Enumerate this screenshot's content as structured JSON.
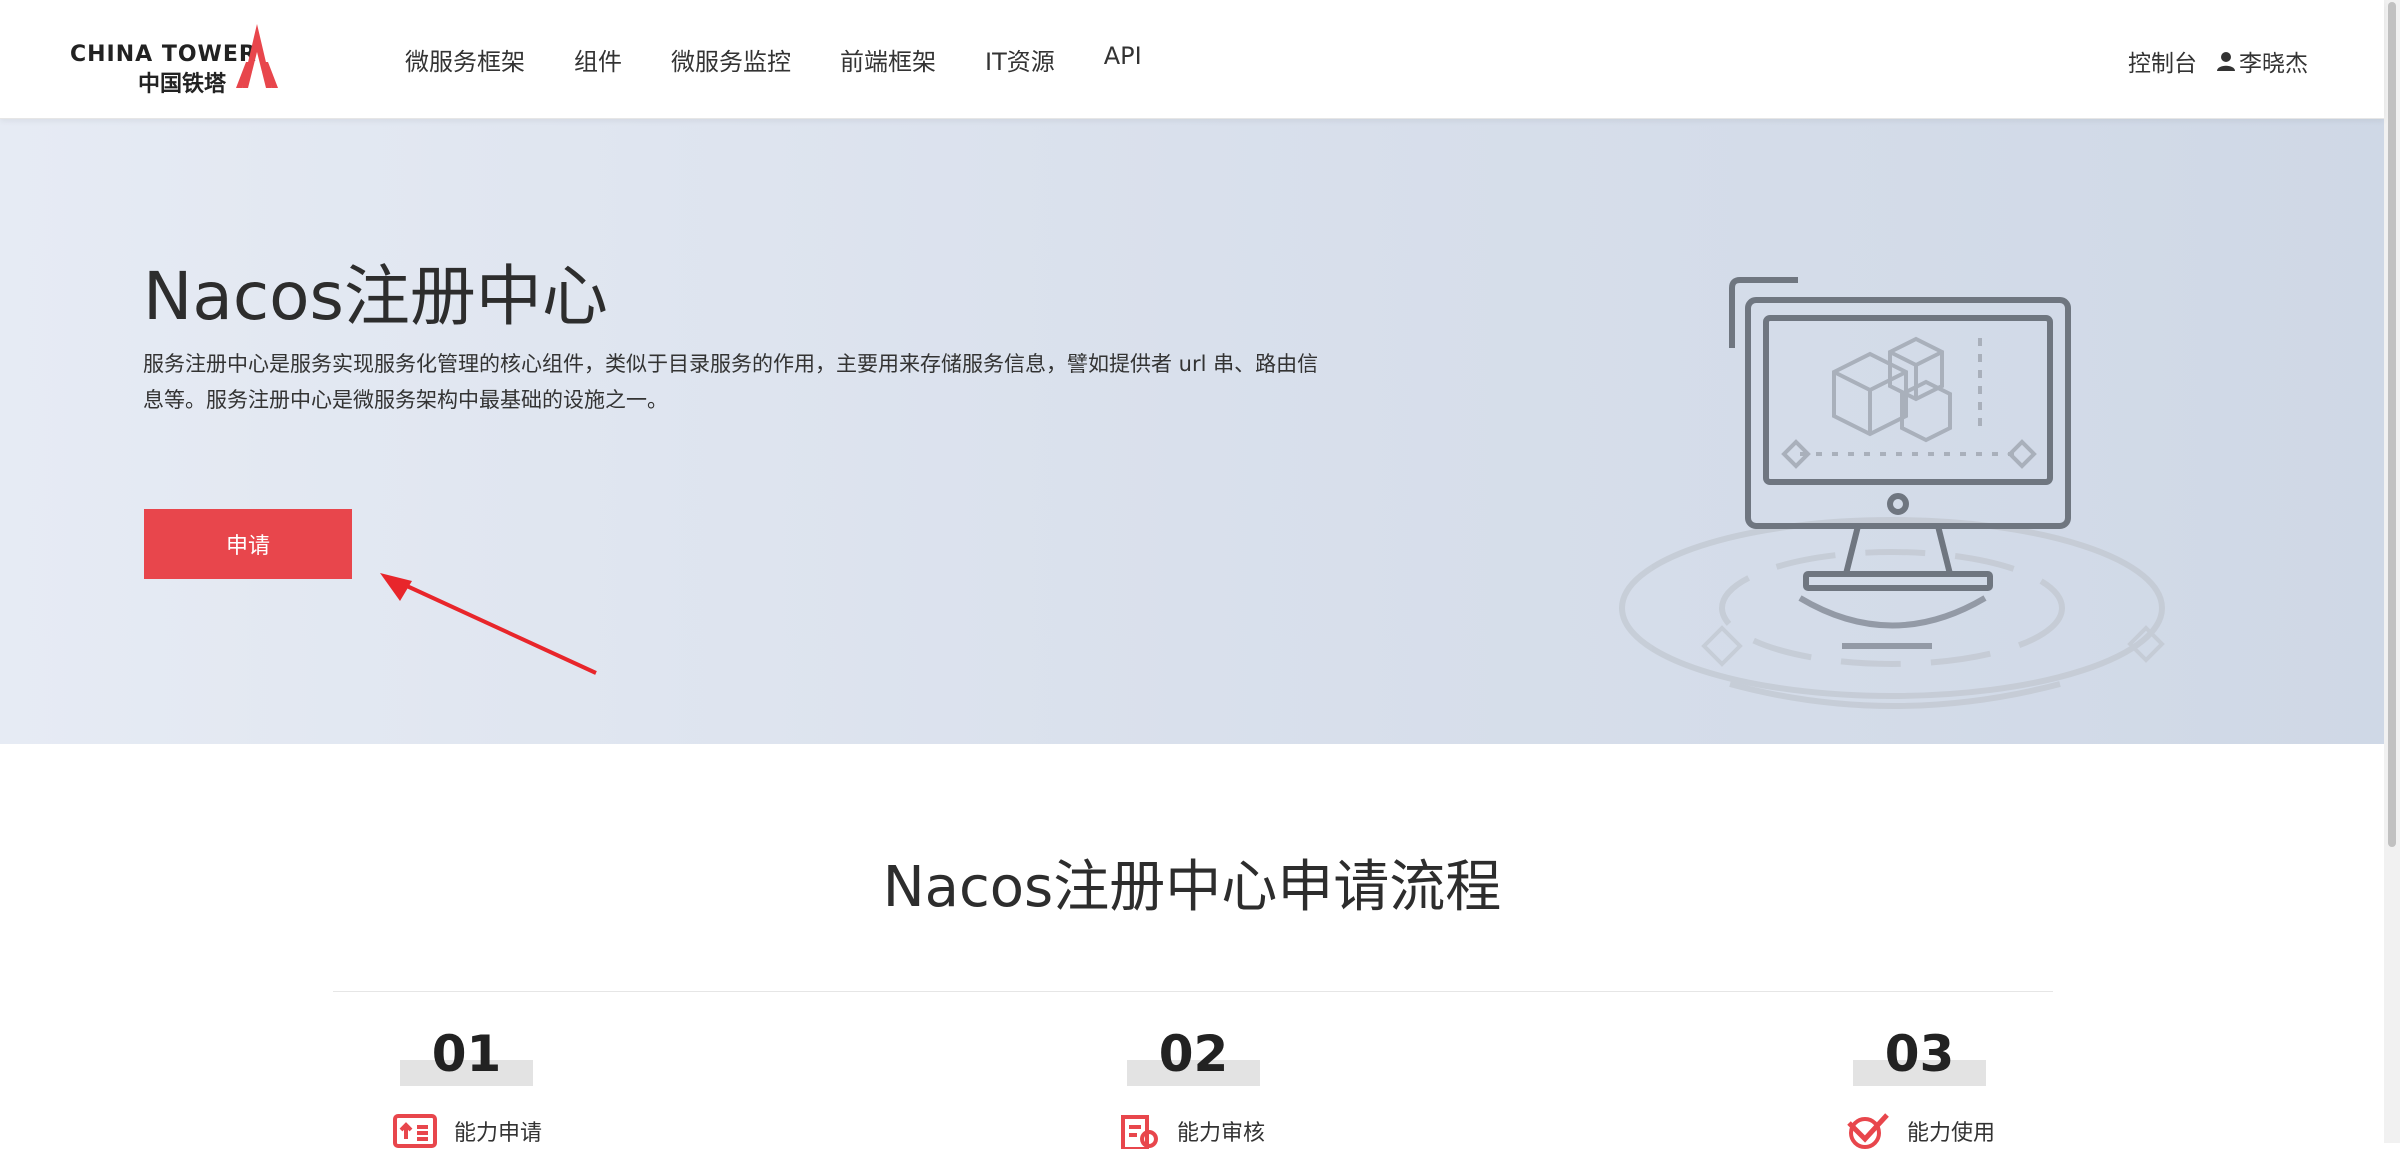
{
  "brand": {
    "name_en": "CHINA TOWER",
    "name_cn": "中国铁塔",
    "accent": "#e8464c"
  },
  "nav": {
    "items": [
      {
        "label": "微服务框架"
      },
      {
        "label": "组件"
      },
      {
        "label": "微服务监控"
      },
      {
        "label": "前端框架"
      },
      {
        "label": "IT资源"
      },
      {
        "label": "API"
      }
    ]
  },
  "header": {
    "console_label": "控制台",
    "user_name": "李晓杰",
    "user_icon": "user-icon"
  },
  "hero": {
    "title": "Nacos注册中心",
    "description": "服务注册中心是服务实现服务化管理的核心组件，类似于目录服务的作用，主要用来存储服务信息，譬如提供者 url 串、路由信息等。服务注册中心是微服务架构中最基础的设施之一。",
    "apply_label": "申请",
    "illustration_icon": "monitor-cubes-illustration"
  },
  "process": {
    "title": "Nacos注册中心申请流程",
    "steps": [
      {
        "number": "01",
        "label": "能力申请",
        "icon": "apply-icon"
      },
      {
        "number": "02",
        "label": "能力审核",
        "icon": "review-icon"
      },
      {
        "number": "03",
        "label": "能力使用",
        "icon": "use-icon"
      }
    ]
  }
}
